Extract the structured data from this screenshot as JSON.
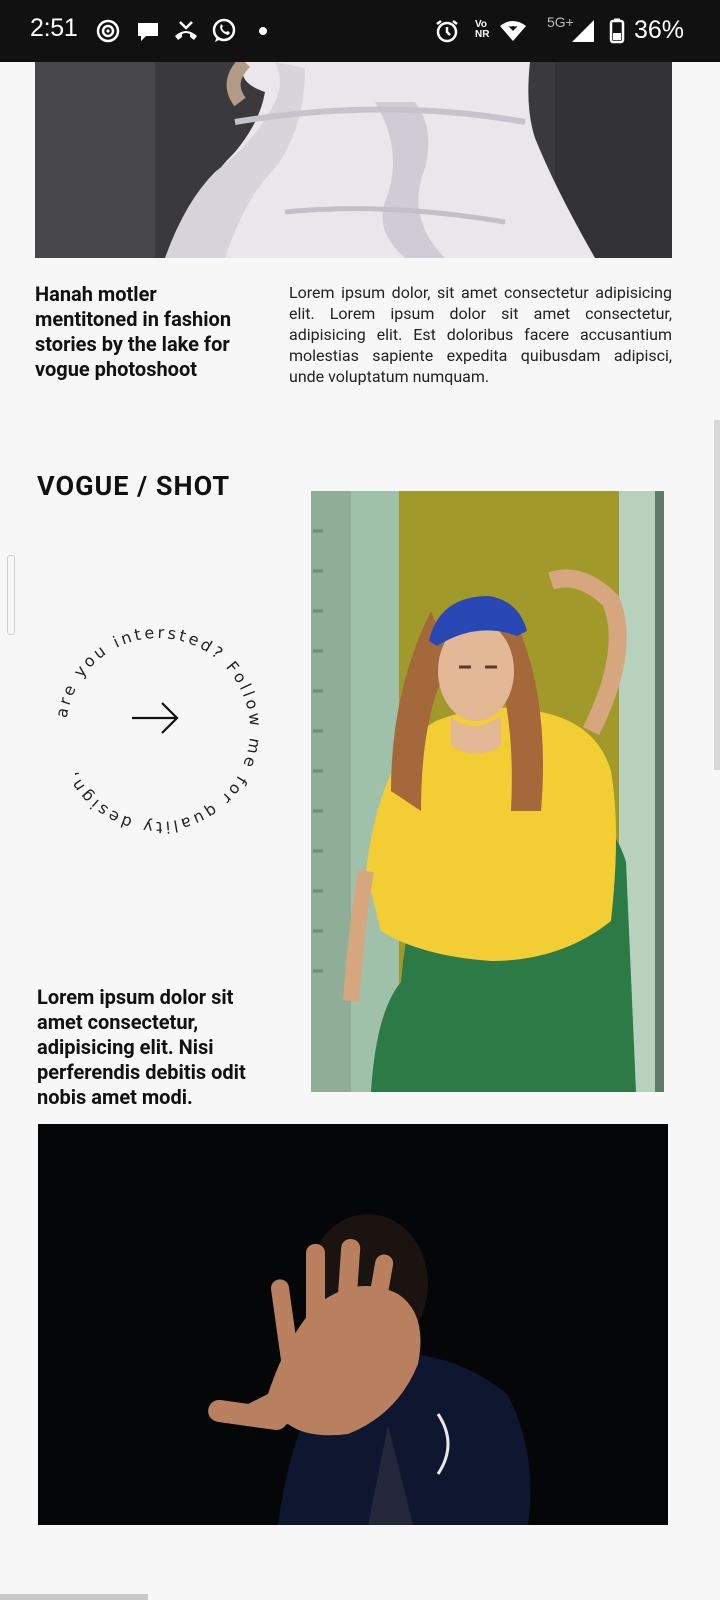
{
  "status_bar": {
    "time": "2:51",
    "battery": "36%",
    "network_top": "Vo",
    "network_bottom": "NR",
    "signal_label": "5G+"
  },
  "section1": {
    "caption": "Hanah motler mentitoned in fashion stories by the lake for vogue photoshoot",
    "description": "Lorem ipsum dolor, sit amet consectetur adipisicing elit. Lorem ipsum dolor sit amet consectetur, adipisicing elit. Est doloribus facere accusantium molestias sapiente expedita quibusdam adipisci, unde voluptatum numquam."
  },
  "section2": {
    "heading": "VOGUE / SHOT",
    "circle_text": "are you intersted? Follow me for quality design, ",
    "caption": "Lorem ipsum dolor sit amet consectetur, adipisicing elit. Nisi perferendis debitis odit nobis amet modi."
  },
  "colors": {
    "status_bar_bg": "#111111",
    "page_bg": "#f7f7f8",
    "text": "#111111"
  },
  "icons": [
    "camera-icon",
    "message-icon",
    "missed-call-icon",
    "whatsapp-icon",
    "alarm-icon",
    "wifi-icon",
    "signal-icon",
    "battery-icon",
    "arrow-right-icon"
  ]
}
